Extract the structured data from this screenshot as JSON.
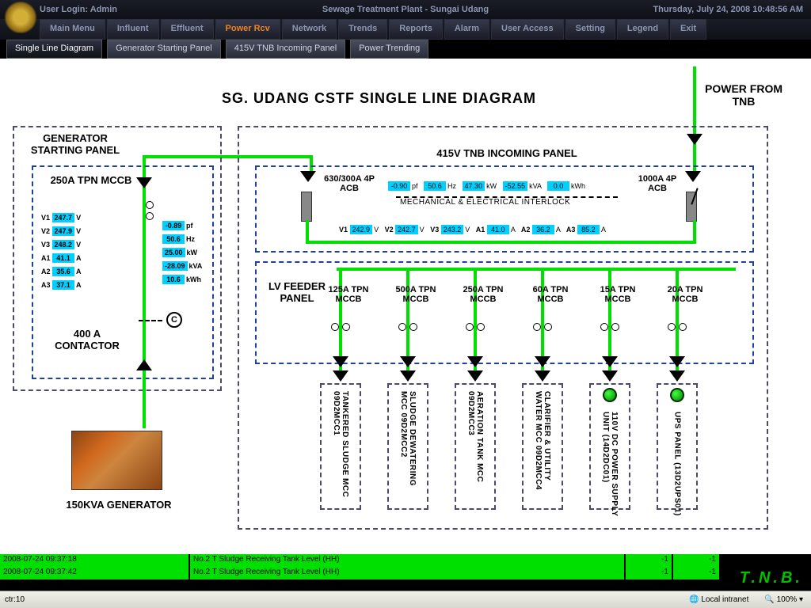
{
  "header": {
    "login": "User Login: Admin",
    "title": "Sewage Treatment Plant - Sungai Udang",
    "datetime": "Thursday, July 24, 2008 10:48:56 AM"
  },
  "menu": [
    "Main Menu",
    "Influent",
    "Effluent",
    "Power Rcv",
    "Network",
    "Trends",
    "Reports",
    "Alarm",
    "User Access",
    "Setting",
    "Legend",
    "Exit"
  ],
  "menu_active": 3,
  "submenu": [
    "Single Line Diagram",
    "Generator Starting Panel",
    "415V TNB Incoming Panel",
    "Power Trending"
  ],
  "submenu_active": 0,
  "diagram": {
    "title": "SG. UDANG CSTF SINGLE LINE DIAGRAM",
    "power_from": "POWER FROM TNB",
    "gen_panel": {
      "label": "GENERATOR STARTING PANEL",
      "breaker": "250A TPN MCCB",
      "contactor": "400 A CONTACTOR",
      "gen_label": "150KVA GENERATOR",
      "volts": [
        {
          "l": "V1",
          "v": "247.7",
          "u": "V"
        },
        {
          "l": "V2",
          "v": "247.9",
          "u": "V"
        },
        {
          "l": "V3",
          "v": "248.2",
          "u": "V"
        },
        {
          "l": "A1",
          "v": "41.1",
          "u": "A"
        },
        {
          "l": "A2",
          "v": "35.6",
          "u": "A"
        },
        {
          "l": "A3",
          "v": "37.1",
          "u": "A"
        }
      ],
      "meters": [
        {
          "v": "-0.89",
          "u": "pf"
        },
        {
          "v": "50.6",
          "u": "Hz"
        },
        {
          "v": "25.00",
          "u": "kW"
        },
        {
          "v": "-28.09",
          "u": "kVA"
        },
        {
          "v": "10.6",
          "u": "kWh"
        }
      ]
    },
    "tnb_panel": {
      "label": "415V TNB INCOMING PANEL",
      "acb_left": "630/300A 4P ACB",
      "acb_right": "1000A 4P ACB",
      "interlock": "MECHANICAL & ELECTRICAL INTERLOCK",
      "top_meters": [
        {
          "v": "-0.90",
          "u": "pf"
        },
        {
          "v": "50.6",
          "u": "Hz"
        },
        {
          "v": "47.30",
          "u": "kW"
        },
        {
          "v": "-52.55",
          "u": "kVA"
        },
        {
          "v": "0.0",
          "u": "kWh"
        }
      ],
      "bus_readings": [
        {
          "l": "V1",
          "v": "242.9",
          "u": "V"
        },
        {
          "l": "V2",
          "v": "242.7",
          "u": "V"
        },
        {
          "l": "V3",
          "v": "243.2",
          "u": "V"
        },
        {
          "l": "A1",
          "v": "41.0",
          "u": "A"
        },
        {
          "l": "A2",
          "v": "36.2",
          "u": "A"
        },
        {
          "l": "A3",
          "v": "85.2",
          "u": "A"
        }
      ]
    },
    "lv_feeder": {
      "label": "LV FEEDER PANEL",
      "feeders": [
        {
          "b": "125A TPN MCCB",
          "load": "TANKERED SLUDGE MCC 09D2MCC1",
          "lamp": false
        },
        {
          "b": "500A TPN MCCB",
          "load": "SLUDGE DEWATERING MCC 09D2MCC2",
          "lamp": false
        },
        {
          "b": "250A TPN MCCB",
          "load": "AERATION TANK MCC 09D2MCC3",
          "lamp": false
        },
        {
          "b": "60A TPN MCCB",
          "load": "CLARIFIER & UTILITY WATER MCC 09D2MCC4",
          "lamp": false
        },
        {
          "b": "15A TPN MCCB",
          "load": "110V DC POWER SUPPLY UNIT (14D2DC01)",
          "lamp": true
        },
        {
          "b": "20A TPN MCCB",
          "load": "UPS PANEL (13D2UPS01)",
          "lamp": true
        }
      ]
    }
  },
  "alarms": [
    {
      "t": "2008-07-24 09:37:18",
      "m": "No.2 T Sludge Receiving Tank Level (HH)",
      "c1": "-1",
      "c2": "-1"
    },
    {
      "t": "2008-07-24 09:37:42",
      "m": "No.2 T Sludge Receiving Tank Level (HH)",
      "c1": "-1",
      "c2": "-1"
    }
  ],
  "status": {
    "ctr": "ctr:10",
    "zone": "Local intranet",
    "zoom": "100%",
    "tnb": "T.N.B."
  }
}
